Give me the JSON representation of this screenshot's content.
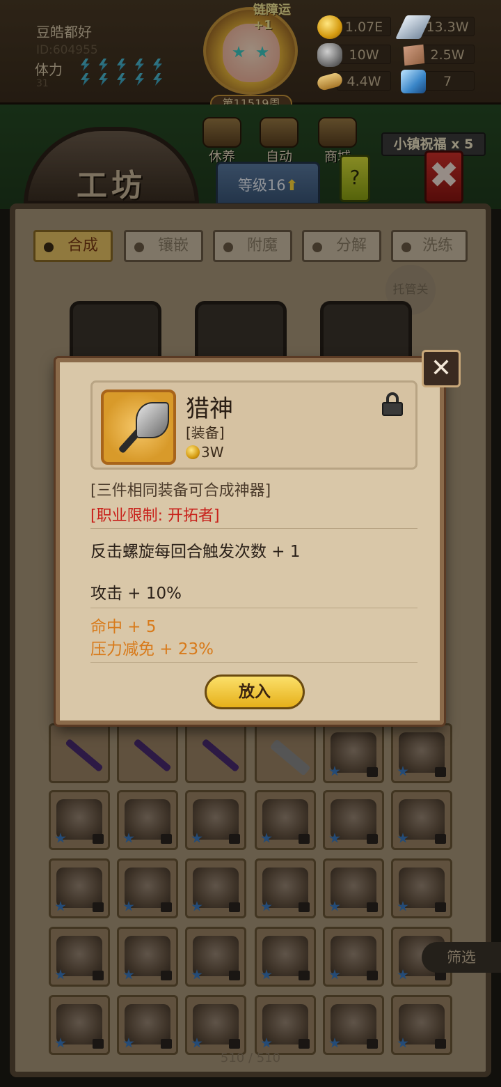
{
  "player": {
    "name": "豆皓都好",
    "id": "ID:604955",
    "stamina_label": "体力",
    "stamina_value": "31",
    "stamina_bolts": 10
  },
  "portrait": {
    "banner": "链障运+1",
    "week": "第11519周"
  },
  "resources": [
    {
      "icon": "gold-coin-icon",
      "value": "1.07E"
    },
    {
      "icon": "silver-bar-icon",
      "value": "13.3W"
    },
    {
      "icon": "ore-icon",
      "value": "10W"
    },
    {
      "icon": "hide-icon",
      "value": "2.5W"
    },
    {
      "icon": "wood-icon",
      "value": "4.4W"
    },
    {
      "icon": "gem-icon",
      "value": "7"
    }
  ],
  "nav": {
    "rest": "休养",
    "auto": "自动",
    "shop": "商城",
    "bless": "小镇祝福 x 5",
    "help": "?",
    "close": "✖"
  },
  "workshop": {
    "title": "工坊",
    "level": "等级16"
  },
  "tabs": [
    {
      "label": "合成",
      "active": true
    },
    {
      "label": "镶嵌",
      "active": false
    },
    {
      "label": "附魔",
      "active": false
    },
    {
      "label": "分解",
      "active": false
    },
    {
      "label": "洗练",
      "active": false
    }
  ],
  "hosting": "托管关",
  "filter": "筛选",
  "capacity": "510 / 510",
  "popup": {
    "item_name": "猎神",
    "item_type": "[装备]",
    "price": "3W",
    "note": "[三件相同装备可合成神器]",
    "class_limit": "[职业限制: 开拓者]",
    "stat_1": "反击螺旋每回合触发次数 + 1",
    "stat_2": "攻击 + 10%",
    "stat_3": "命中 + 5",
    "stat_4": "压力减免 + 23%",
    "place_button": "放入",
    "close": "✕"
  },
  "colors": {
    "red_text": "#c8201a",
    "orange_text": "#d87a1a",
    "gold_button": "#f2c83a"
  }
}
